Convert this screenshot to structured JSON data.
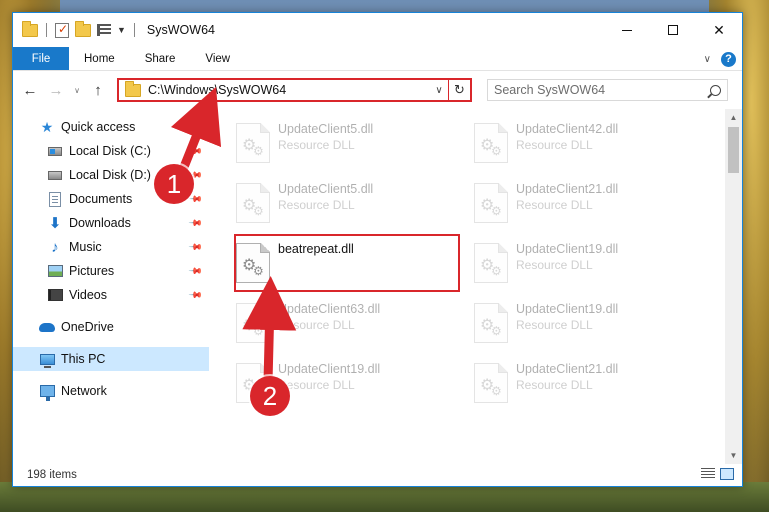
{
  "window": {
    "title": "SysWOW64",
    "controls": {
      "minimize": "–",
      "maximize": "☐",
      "close": "✕"
    }
  },
  "ribbon": {
    "tabs": [
      {
        "label": "File",
        "active": true
      },
      {
        "label": "Home"
      },
      {
        "label": "Share"
      },
      {
        "label": "View"
      }
    ],
    "help": "?"
  },
  "address": {
    "path": "C:\\Windows\\SysWOW64",
    "search_placeholder": "Search SysWOW64"
  },
  "nav": {
    "quick_access": "Quick access",
    "items": [
      {
        "label": "Local Disk (C:)",
        "icon": "disk-icon",
        "pinned": true
      },
      {
        "label": "Local Disk (D:)",
        "icon": "disk-icon",
        "pinned": true
      },
      {
        "label": "Documents",
        "icon": "documents-icon",
        "pinned": true
      },
      {
        "label": "Downloads",
        "icon": "downloads-icon",
        "pinned": true
      },
      {
        "label": "Music",
        "icon": "music-icon",
        "pinned": true
      },
      {
        "label": "Pictures",
        "icon": "pictures-icon",
        "pinned": true
      },
      {
        "label": "Videos",
        "icon": "videos-icon",
        "pinned": true
      }
    ],
    "onedrive": "OneDrive",
    "this_pc": "This PC",
    "network": "Network"
  },
  "files": [
    {
      "name": "UpdateClient5.dll",
      "type": "Resource DLL",
      "faded": true
    },
    {
      "name": "UpdateClient42.dll",
      "type": "Resource DLL",
      "faded": true
    },
    {
      "name": "UpdateClient5.dll",
      "type": "Resource DLL",
      "faded": true
    },
    {
      "name": "UpdateClient21.dll",
      "type": "Resource DLL",
      "faded": true
    },
    {
      "name": "beatrepeat.dll",
      "type": "",
      "faded": false
    },
    {
      "name": "UpdateClient19.dll",
      "type": "Resource DLL",
      "faded": true
    },
    {
      "name": "UpdateClient63.dll",
      "type": "Resource DLL",
      "faded": true
    },
    {
      "name": "UpdateClient19.dll",
      "type": "Resource DLL",
      "faded": true
    },
    {
      "name": "UpdateClient19.dll",
      "type": "Resource DLL",
      "faded": true
    },
    {
      "name": "UpdateClient21.dll",
      "type": "Resource DLL",
      "faded": true
    }
  ],
  "status": {
    "item_count": "198 items"
  },
  "callouts": {
    "first": "1",
    "second": "2"
  },
  "colors": {
    "accent": "#1979ca",
    "highlight": "#d9262b",
    "selected": "#cce8ff"
  }
}
